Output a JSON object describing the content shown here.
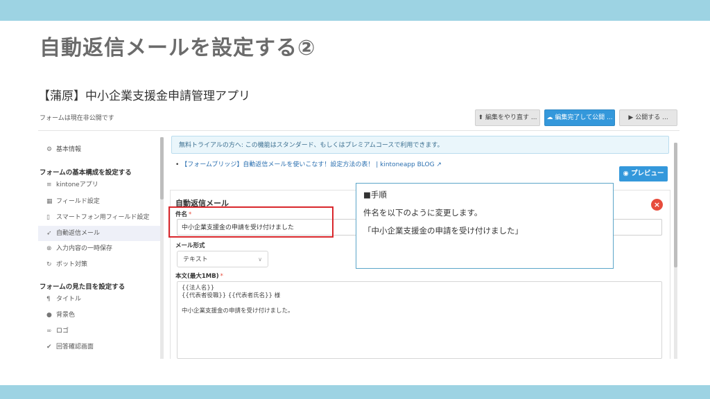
{
  "slide": {
    "title": "自動返信メールを設定する②"
  },
  "app": {
    "title": "【蒲原】中小企業支援金申請管理アプリ",
    "status": "フォームは現在非公開です"
  },
  "toolbar": {
    "revert_label": "編集をやり直す ...",
    "save_label": "編集完了して公開 ...",
    "publish_label": "公開する ..."
  },
  "sidebar": {
    "basic_info": "基本情報",
    "section1_heading": "フォームの基本構成を設定する",
    "section1_items": [
      "kintoneアプリ",
      "フィールド設定",
      "スマートフォン用フィールド設定",
      "自動返信メール",
      "入力内容の一時保存",
      "ボット対策"
    ],
    "section2_heading": "フォームの見た目を設定する",
    "section2_items": [
      "タイトル",
      "背景色",
      "ロゴ",
      "回答確認画面"
    ]
  },
  "main": {
    "notice": "無料トライアルの方へ: この機能はスタンダード、もしくはプレミアムコースで利用できます。",
    "blog_link_prefix": "•",
    "blog_link": "【フォームブリッジ】自動返信メールを使いこなす！設定方法の表！ | kintoneapp BLOG",
    "preview_label": "プレビュー",
    "section_title": "自動返信メール",
    "subject_label": "件名",
    "subject_value": "中小企業支援金の申請を受け付けました",
    "format_label": "メール形式",
    "format_value": "テキスト",
    "body_label": "本文(最大1MB)",
    "body_lines": [
      "{{法人名}}",
      "{{代表者役職}} {{代表者氏名}} 様",
      "",
      "中小企業支援金の申請を受け付けました。"
    ]
  },
  "callout": {
    "heading": "■手順",
    "line1": "件名を以下のように変更します。",
    "line2": "「中小企業支援金の申請を受け付けました」"
  }
}
